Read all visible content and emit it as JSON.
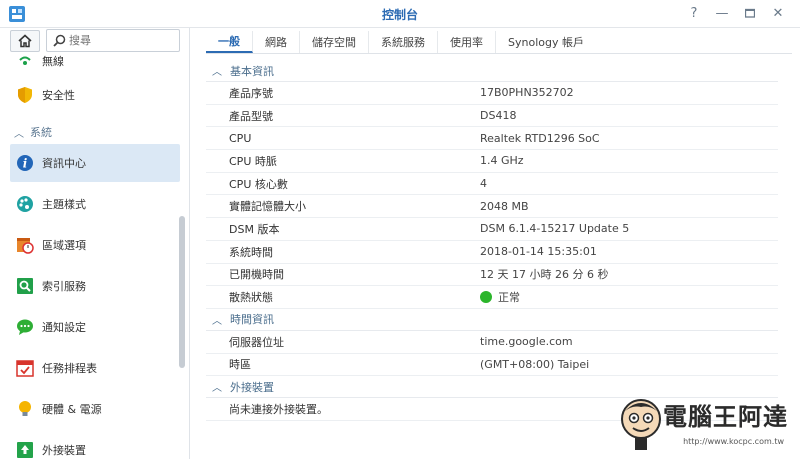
{
  "window": {
    "title": "控制台",
    "help_icon": "question-icon",
    "minimize_icon": "minimize-icon",
    "maximize_icon": "maximize-icon",
    "close_icon": "close-icon"
  },
  "sidebar": {
    "search_placeholder": "搜尋",
    "items_top": [
      {
        "label": "無線",
        "icon": "wifi-icon"
      },
      {
        "label": "安全性",
        "icon": "shield-icon"
      }
    ],
    "section": "系統",
    "items": [
      {
        "label": "資訊中心",
        "icon": "info-icon",
        "active": true
      },
      {
        "label": "主題樣式",
        "icon": "palette-icon"
      },
      {
        "label": "區域選項",
        "icon": "calendar-clock-icon"
      },
      {
        "label": "索引服務",
        "icon": "index-search-icon"
      },
      {
        "label": "通知設定",
        "icon": "chat-bubble-icon"
      },
      {
        "label": "任務排程表",
        "icon": "calendar-check-icon"
      },
      {
        "label": "硬體 & 電源",
        "icon": "lightbulb-icon"
      },
      {
        "label": "外接裝置",
        "icon": "upload-device-icon"
      }
    ]
  },
  "tabs": [
    "一般",
    "網路",
    "儲存空間",
    "系統服務",
    "使用率",
    "Synology 帳戶"
  ],
  "groups": {
    "basic": {
      "title": "基本資訊",
      "rows": [
        {
          "k": "產品序號",
          "v": "17B0PHN352702"
        },
        {
          "k": "產品型號",
          "v": "DS418"
        },
        {
          "k": "CPU",
          "v": "Realtek RTD1296 SoC"
        },
        {
          "k": "CPU 時脈",
          "v": "1.4 GHz"
        },
        {
          "k": "CPU 核心數",
          "v": "4"
        },
        {
          "k": "實體記憶體大小",
          "v": "2048 MB"
        },
        {
          "k": "DSM 版本",
          "v": "DSM 6.1.4-15217 Update 5"
        },
        {
          "k": "系統時間",
          "v": "2018-01-14 15:35:01"
        },
        {
          "k": "已開機時間",
          "v": "12 天 17 小時 26 分 6 秒"
        },
        {
          "k": "散熱狀態",
          "v": "正常"
        }
      ]
    },
    "time": {
      "title": "時間資訊",
      "rows": [
        {
          "k": "伺服器位址",
          "v": "time.google.com"
        },
        {
          "k": "時區",
          "v": "(GMT+08:00) Taipei"
        }
      ]
    },
    "external": {
      "title": "外接裝置",
      "rows": [
        {
          "k": "尚未連接外接裝置。"
        }
      ]
    }
  },
  "watermark": {
    "title": "電腦王阿達",
    "url": "http://www.kocpc.com.tw"
  },
  "colors": {
    "accent": "#2c6bb3",
    "active_bg": "#dbe8f5",
    "status_ok": "#2bb52b"
  }
}
